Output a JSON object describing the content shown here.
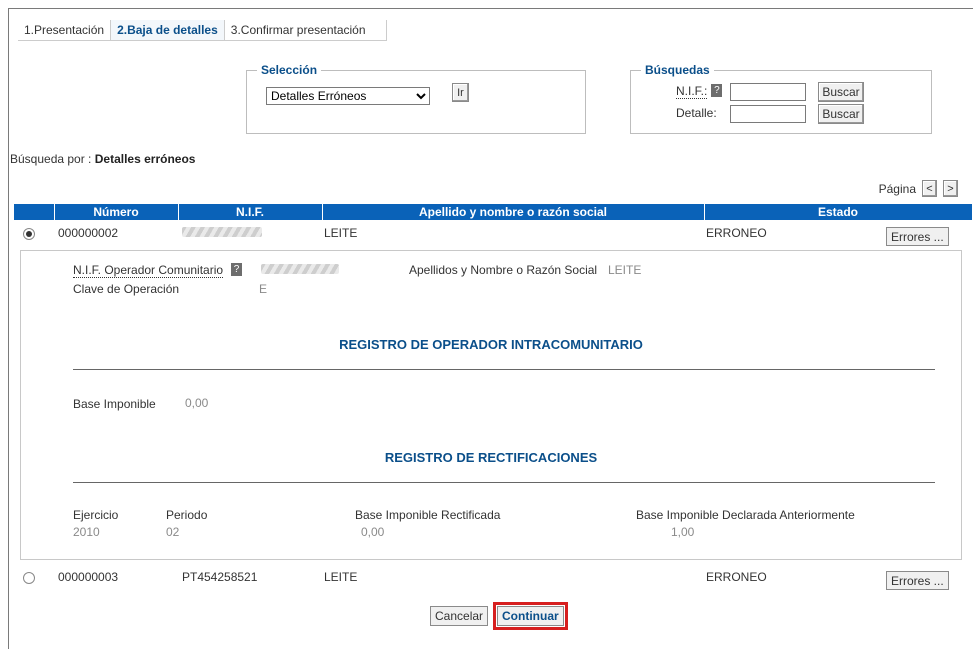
{
  "tabs": [
    {
      "label": "1.Presentación"
    },
    {
      "label": "2.Baja de detalles"
    },
    {
      "label": "3.Confirmar presentación"
    }
  ],
  "seleccion": {
    "legend": "Selección",
    "selected": "Detalles Erróneos",
    "go_label": "Ir"
  },
  "busquedas": {
    "legend": "Búsquedas",
    "nif_label": "N.I.F.:",
    "detalle_label": "Detalle:",
    "buscar_label": "Buscar",
    "help": "?"
  },
  "search_by": {
    "prefix": "Búsqueda por :",
    "value": "Detalles erróneos"
  },
  "pager": {
    "label": "Página",
    "prev": "<",
    "next": ">"
  },
  "grid": {
    "columns": [
      "Número",
      "N.I.F.",
      "Apellido y nombre o razón social",
      "Estado"
    ],
    "rows": [
      {
        "numero": "000000002",
        "nif": "",
        "nombre": "LEITE",
        "estado": "ERRONEO",
        "errores": "Errores ..."
      },
      {
        "numero": "000000003",
        "nif": "PT454258521",
        "nombre": "LEITE",
        "estado": "ERRONEO",
        "errores": "Errores ..."
      }
    ]
  },
  "detail": {
    "nif_op_label": "N.I.F. Operador Comunitario",
    "clave_label": "Clave de Operación",
    "clave_value": "E",
    "apellidos_label": "Apellidos y Nombre o Razón Social",
    "apellidos_value": "LEITE",
    "section1": "REGISTRO DE OPERADOR INTRACOMUNITARIO",
    "base_label": "Base Imponible",
    "base_value": "0,00",
    "section2": "REGISTRO DE RECTIFICACIONES",
    "ejercicio_label": "Ejercicio",
    "ejercicio_value": "2010",
    "periodo_label": "Periodo",
    "periodo_value": "02",
    "base_rect_label": "Base Imponible Rectificada",
    "base_rect_value": "0,00",
    "base_decl_label": "Base Imponible Declarada Anteriormente",
    "base_decl_value": "1,00"
  },
  "footer": {
    "cancel": "Cancelar",
    "continue": "Continuar"
  },
  "colors": {
    "header_blue": "#0a62b8",
    "section_blue": "#0b4f8a",
    "highlight_red": "#d61f1f"
  }
}
